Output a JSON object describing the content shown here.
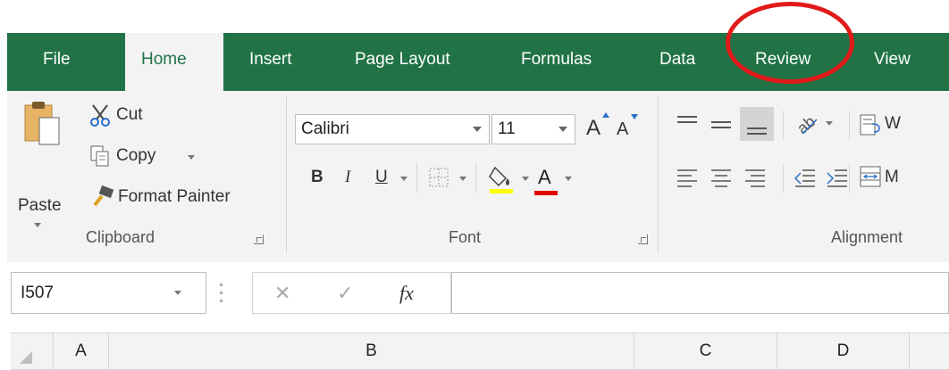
{
  "tabs": [
    {
      "label": "File",
      "active": false
    },
    {
      "label": "Home",
      "active": true
    },
    {
      "label": "Insert",
      "active": false
    },
    {
      "label": "Page Layout",
      "active": false
    },
    {
      "label": "Formulas",
      "active": false
    },
    {
      "label": "Data",
      "active": false
    },
    {
      "label": "Review",
      "active": false
    },
    {
      "label": "View",
      "active": false
    }
  ],
  "clipboard": {
    "group_label": "Clipboard",
    "paste_label": "Paste",
    "cut_label": "Cut",
    "copy_label": "Copy",
    "format_painter_label": "Format Painter"
  },
  "font": {
    "group_label": "Font",
    "font_name": "Calibri",
    "font_size": "11",
    "grow_label": "A",
    "shrink_label": "A",
    "bold_label": "B",
    "italic_label": "I",
    "underline_label": "U",
    "font_color_label": "A",
    "fill_color": "#ffff00",
    "font_color": "#e00000"
  },
  "alignment": {
    "group_label": "Alignment",
    "wrap_label": "W",
    "merge_label": "M"
  },
  "formula_bar": {
    "name_box": "I507",
    "fx_label": "fx",
    "cancel_label": "✕",
    "enter_label": "✓",
    "value": ""
  },
  "columns": [
    "A",
    "B",
    "C",
    "D"
  ],
  "colors": {
    "ribbon_green": "#217346",
    "annotation_red": "#e11a1a"
  }
}
